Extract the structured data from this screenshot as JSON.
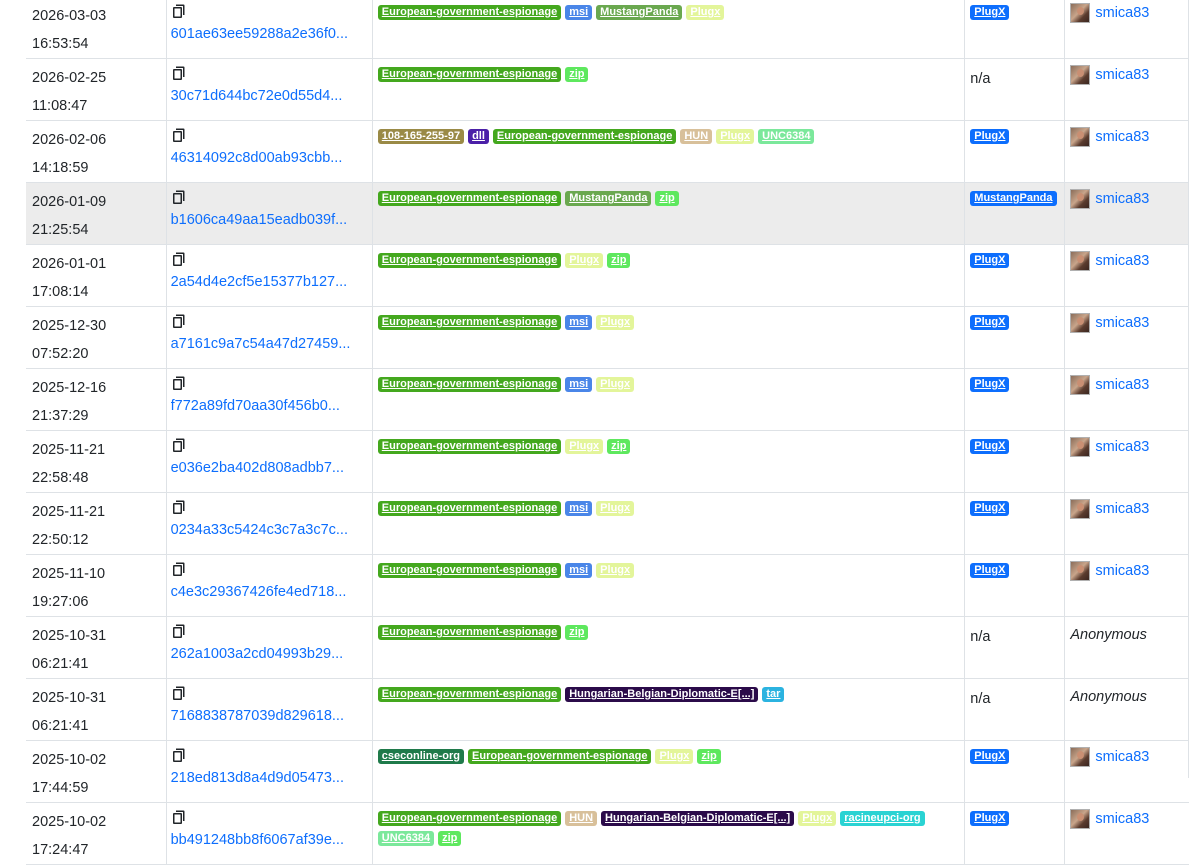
{
  "tag_colors": {
    "European-government-espionage": {
      "bg": "#44a81e",
      "fg": "#ffffff"
    },
    "msi": {
      "bg": "#4a86e8",
      "fg": "#ffffff"
    },
    "MustangPanda": {
      "bg": "#6aa84f",
      "fg": "#ffffff"
    },
    "Plugx": {
      "bg": "#e3f59a",
      "fg": "#ffffff"
    },
    "zip": {
      "bg": "#5ee85e",
      "fg": "#ffffff"
    },
    "108-165-255-97": {
      "bg": "#9a8a46",
      "fg": "#ffffff"
    },
    "dll": {
      "bg": "#4b1fa8",
      "fg": "#ffffff"
    },
    "HUN": {
      "bg": "#d8c09a",
      "fg": "#ffffff"
    },
    "UNC6384": {
      "bg": "#7be89b",
      "fg": "#ffffff"
    },
    "Hungarian-Belgian-Diplomatic-E[...]": {
      "bg": "#2b0b4a",
      "fg": "#ffffff"
    },
    "tar": {
      "bg": "#2bb3e0",
      "fg": "#ffffff"
    },
    "cseconline-org": {
      "bg": "#1f7a4a",
      "fg": "#ffffff"
    },
    "racineupci-org": {
      "bg": "#2ad3d3",
      "fg": "#ffffff"
    }
  },
  "signature_color": "#0d6efd",
  "rows": [
    {
      "date": "2026-03-03",
      "time": "16:53:54",
      "hash": "601ae63ee59288a2e36f0...",
      "tags": [
        "European-government-espionage",
        "msi",
        "MustangPanda",
        "Plugx"
      ],
      "signature": "PlugX",
      "reporter": "smica83",
      "reporter_avatar": true,
      "highlight": false
    },
    {
      "date": "2026-02-25",
      "time": "11:08:47",
      "hash": "30c71d644bc72e0d55d4...",
      "tags": [
        "European-government-espionage",
        "zip"
      ],
      "signature": "n/a",
      "reporter": "smica83",
      "reporter_avatar": true,
      "highlight": false
    },
    {
      "date": "2026-02-06",
      "time": "14:18:59",
      "hash": "46314092c8d00ab93cbb...",
      "tags": [
        "108-165-255-97",
        "dll",
        "European-government-espionage",
        "HUN",
        "Plugx",
        "UNC6384"
      ],
      "signature": "PlugX",
      "reporter": "smica83",
      "reporter_avatar": true,
      "highlight": false
    },
    {
      "date": "2026-01-09",
      "time": "21:25:54",
      "hash": "b1606ca49aa15eadb039f...",
      "tags": [
        "European-government-espionage",
        "MustangPanda",
        "zip"
      ],
      "signature": "MustangPanda",
      "reporter": "smica83",
      "reporter_avatar": true,
      "highlight": true
    },
    {
      "date": "2026-01-01",
      "time": "17:08:14",
      "hash": "2a54d4e2cf5e15377b127...",
      "tags": [
        "European-government-espionage",
        "Plugx",
        "zip"
      ],
      "signature": "PlugX",
      "reporter": "smica83",
      "reporter_avatar": true,
      "highlight": false
    },
    {
      "date": "2025-12-30",
      "time": "07:52:20",
      "hash": "a7161c9a7c54a47d27459...",
      "tags": [
        "European-government-espionage",
        "msi",
        "Plugx"
      ],
      "signature": "PlugX",
      "reporter": "smica83",
      "reporter_avatar": true,
      "highlight": false
    },
    {
      "date": "2025-12-16",
      "time": "21:37:29",
      "hash": "f772a89fd70aa30f456b0...",
      "tags": [
        "European-government-espionage",
        "msi",
        "Plugx"
      ],
      "signature": "PlugX",
      "reporter": "smica83",
      "reporter_avatar": true,
      "highlight": false
    },
    {
      "date": "2025-11-21",
      "time": "22:58:48",
      "hash": "e036e2ba402d808adbb7...",
      "tags": [
        "European-government-espionage",
        "Plugx",
        "zip"
      ],
      "signature": "PlugX",
      "reporter": "smica83",
      "reporter_avatar": true,
      "highlight": false
    },
    {
      "date": "2025-11-21",
      "time": "22:50:12",
      "hash": "0234a33c5424c3c7a3c7c...",
      "tags": [
        "European-government-espionage",
        "msi",
        "Plugx"
      ],
      "signature": "PlugX",
      "reporter": "smica83",
      "reporter_avatar": true,
      "highlight": false
    },
    {
      "date": "2025-11-10",
      "time": "19:27:06",
      "hash": "c4e3c29367426fe4ed718...",
      "tags": [
        "European-government-espionage",
        "msi",
        "Plugx"
      ],
      "signature": "PlugX",
      "reporter": "smica83",
      "reporter_avatar": true,
      "highlight": false
    },
    {
      "date": "2025-10-31",
      "time": "06:21:41",
      "hash": "262a1003a2cd04993b29...",
      "tags": [
        "European-government-espionage",
        "zip"
      ],
      "signature": "n/a",
      "reporter": "Anonymous",
      "reporter_avatar": false,
      "highlight": false
    },
    {
      "date": "2025-10-31",
      "time": "06:21:41",
      "hash": "7168838787039d829618...",
      "tags": [
        "European-government-espionage",
        "Hungarian-Belgian-Diplomatic-E[...]",
        "tar"
      ],
      "signature": "n/a",
      "reporter": "Anonymous",
      "reporter_avatar": false,
      "highlight": false
    },
    {
      "date": "2025-10-02",
      "time": "17:44:59",
      "hash": "218ed813d8a4d9d05473...",
      "tags": [
        "cseconline-org",
        "European-government-espionage",
        "Plugx",
        "zip"
      ],
      "signature": "PlugX",
      "reporter": "smica83",
      "reporter_avatar": true,
      "highlight": false
    },
    {
      "date": "2025-10-02",
      "time": "17:24:47",
      "hash": "bb491248bb8f6067af39e...",
      "tags": [
        "European-government-espionage",
        "HUN",
        "Hungarian-Belgian-Diplomatic-E[...]",
        "Plugx",
        "racineupci-org",
        "UNC6384",
        "zip"
      ],
      "signature": "PlugX",
      "reporter": "smica83",
      "reporter_avatar": true,
      "highlight": false
    }
  ]
}
